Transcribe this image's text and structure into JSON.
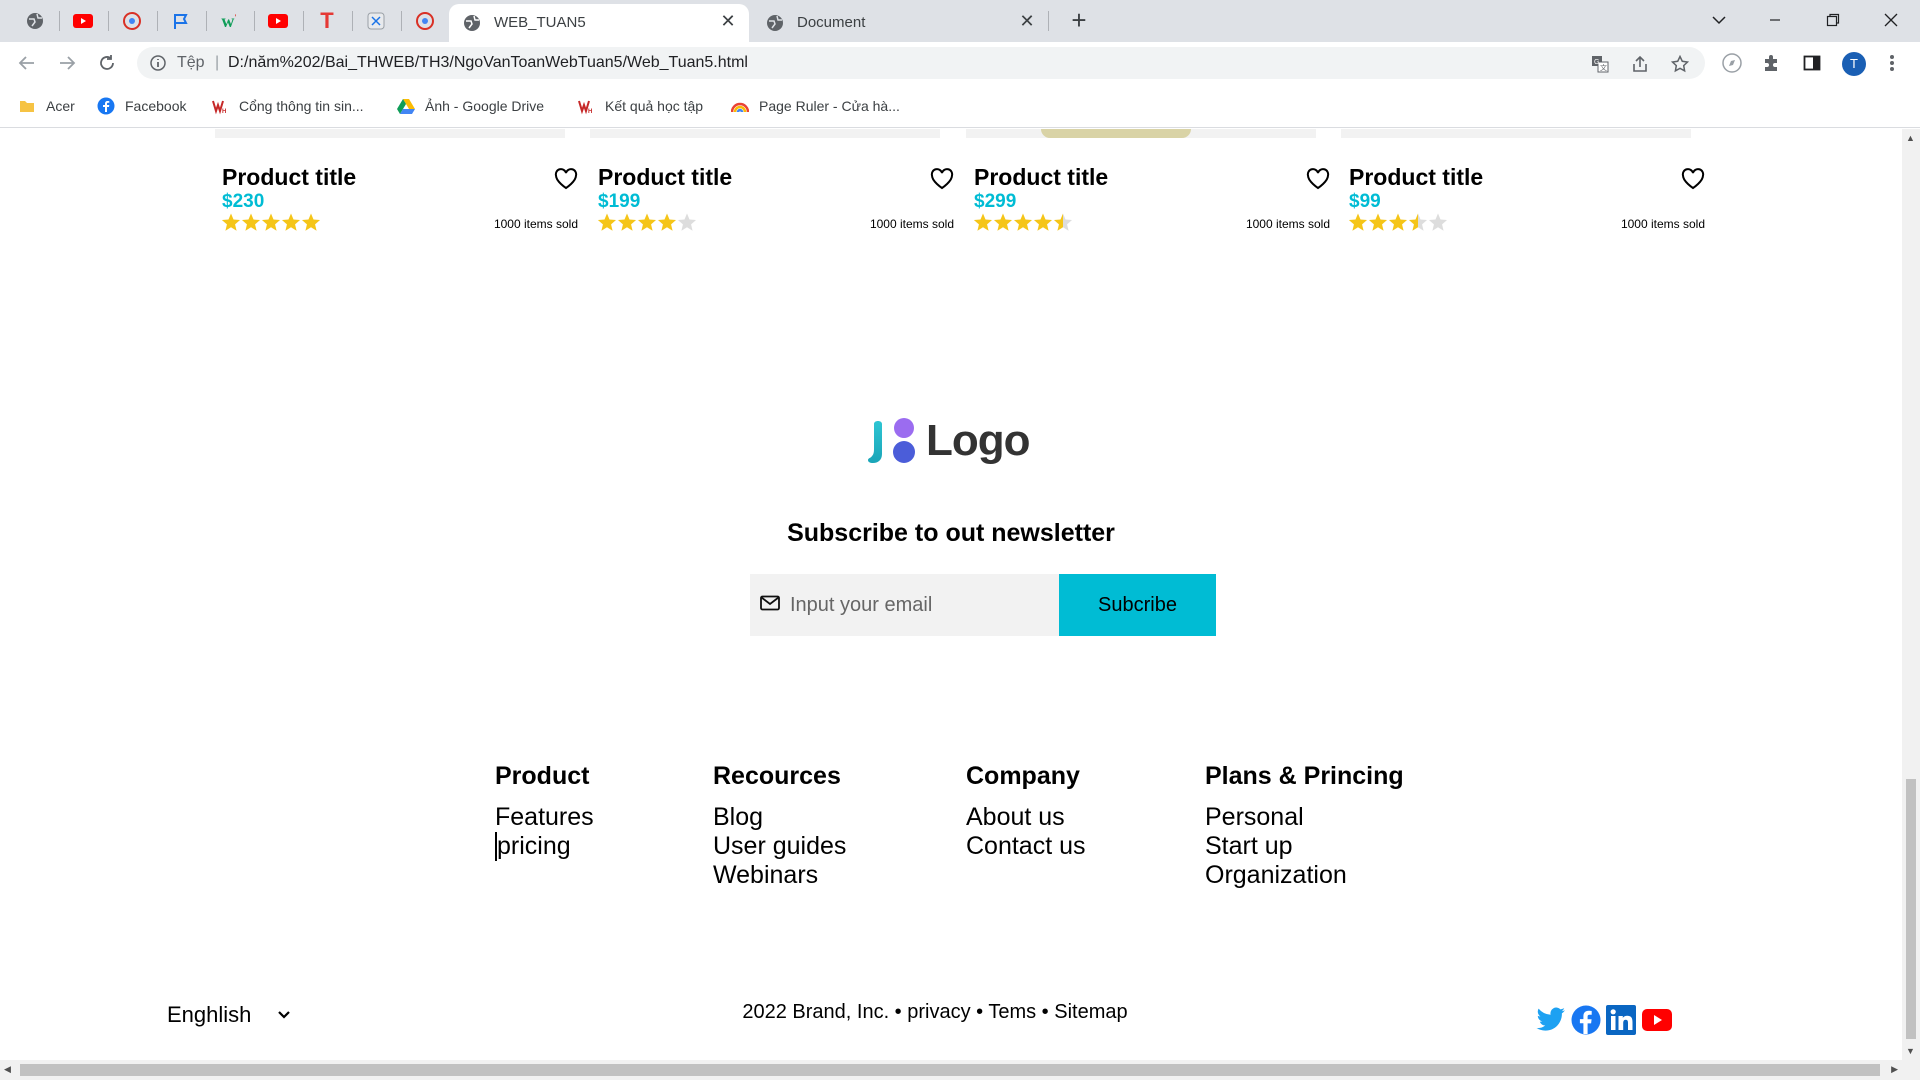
{
  "browser": {
    "active_tab_title": "WEB_TUAN5",
    "inactive_tab_title": "Document",
    "url_scheme_label": "Tệp",
    "url_separator": "|",
    "url": "D:/năm%202/Bai_THWEB/TH3/NgoVanToanWebTuan5/Web_Tuan5.html",
    "profile_initial": "T",
    "new_tab_symbol": "+",
    "close_symbol": "✕"
  },
  "bookmarks": [
    {
      "label": "Acer",
      "icon": "folder-icon"
    },
    {
      "label": "Facebook",
      "icon": "facebook-icon"
    },
    {
      "label": "Cổng thông tin sin...",
      "icon": "university-icon"
    },
    {
      "label": "Ảnh - Google Drive",
      "icon": "google-drive-icon"
    },
    {
      "label": "Kết quả học tập",
      "icon": "university-icon"
    },
    {
      "label": "Page Ruler - Cửa hà...",
      "icon": "rainbow-icon"
    }
  ],
  "products": [
    {
      "title": "Product title",
      "price": "$230",
      "rating": 5,
      "sold": "1000 items sold"
    },
    {
      "title": "Product title",
      "price": "$199",
      "rating": 4,
      "sold": "1000 items sold"
    },
    {
      "title": "Product title",
      "price": "$299",
      "rating": 4.5,
      "sold": "1000 items sold"
    },
    {
      "title": "Product title",
      "price": "$99",
      "rating": 3.5,
      "sold": "1000 items sold"
    }
  ],
  "logo": {
    "text": "Logo"
  },
  "newsletter": {
    "title": "Subscribe to out newsletter",
    "placeholder": "Input your email",
    "button": "Subcribe"
  },
  "footer": {
    "columns": [
      {
        "heading": "Product",
        "links": [
          "Features",
          "pricing"
        ]
      },
      {
        "heading": "Recources",
        "links": [
          "Blog",
          "User guides",
          "Webinars"
        ]
      },
      {
        "heading": "Company",
        "links": [
          "About us",
          "Contact us"
        ]
      },
      {
        "heading": "Plans & Princing",
        "links": [
          "Personal",
          "Start up",
          "Organization"
        ]
      }
    ],
    "language": "Enghlish",
    "copyright": "2022 Brand, Inc. • privacy • Tems • Sitemap",
    "social": [
      "twitter-icon",
      "facebook-icon",
      "linkedin-icon",
      "youtube-icon"
    ]
  },
  "colors": {
    "accent": "#00bcd4",
    "star": "#f5c518",
    "star_empty": "#dddddd"
  }
}
